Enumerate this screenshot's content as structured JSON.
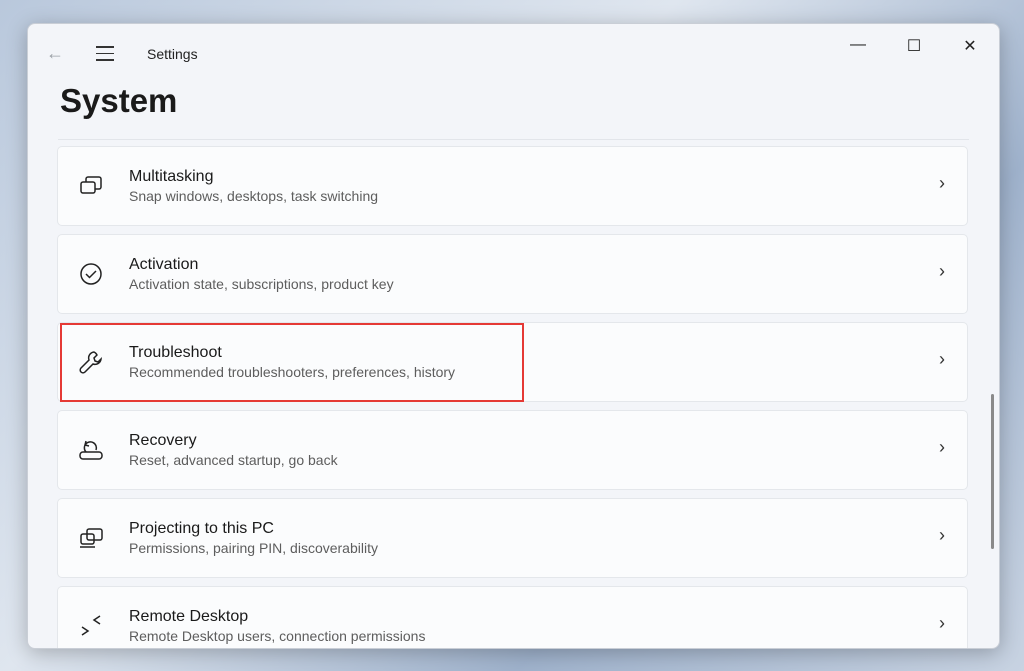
{
  "window": {
    "title": "Settings",
    "page_title": "System"
  },
  "items": [
    {
      "title": "Multitasking",
      "subtitle": "Snap windows, desktops, task switching",
      "icon": "multitasking-icon"
    },
    {
      "title": "Activation",
      "subtitle": "Activation state, subscriptions, product key",
      "icon": "check-circle-icon"
    },
    {
      "title": "Troubleshoot",
      "subtitle": "Recommended troubleshooters, preferences, history",
      "icon": "wrench-icon"
    },
    {
      "title": "Recovery",
      "subtitle": "Reset, advanced startup, go back",
      "icon": "recovery-icon"
    },
    {
      "title": "Projecting to this PC",
      "subtitle": "Permissions, pairing PIN, discoverability",
      "icon": "projecting-icon"
    },
    {
      "title": "Remote Desktop",
      "subtitle": "Remote Desktop users, connection permissions",
      "icon": "remote-desktop-icon"
    }
  ],
  "highlight_color": "#e53935"
}
